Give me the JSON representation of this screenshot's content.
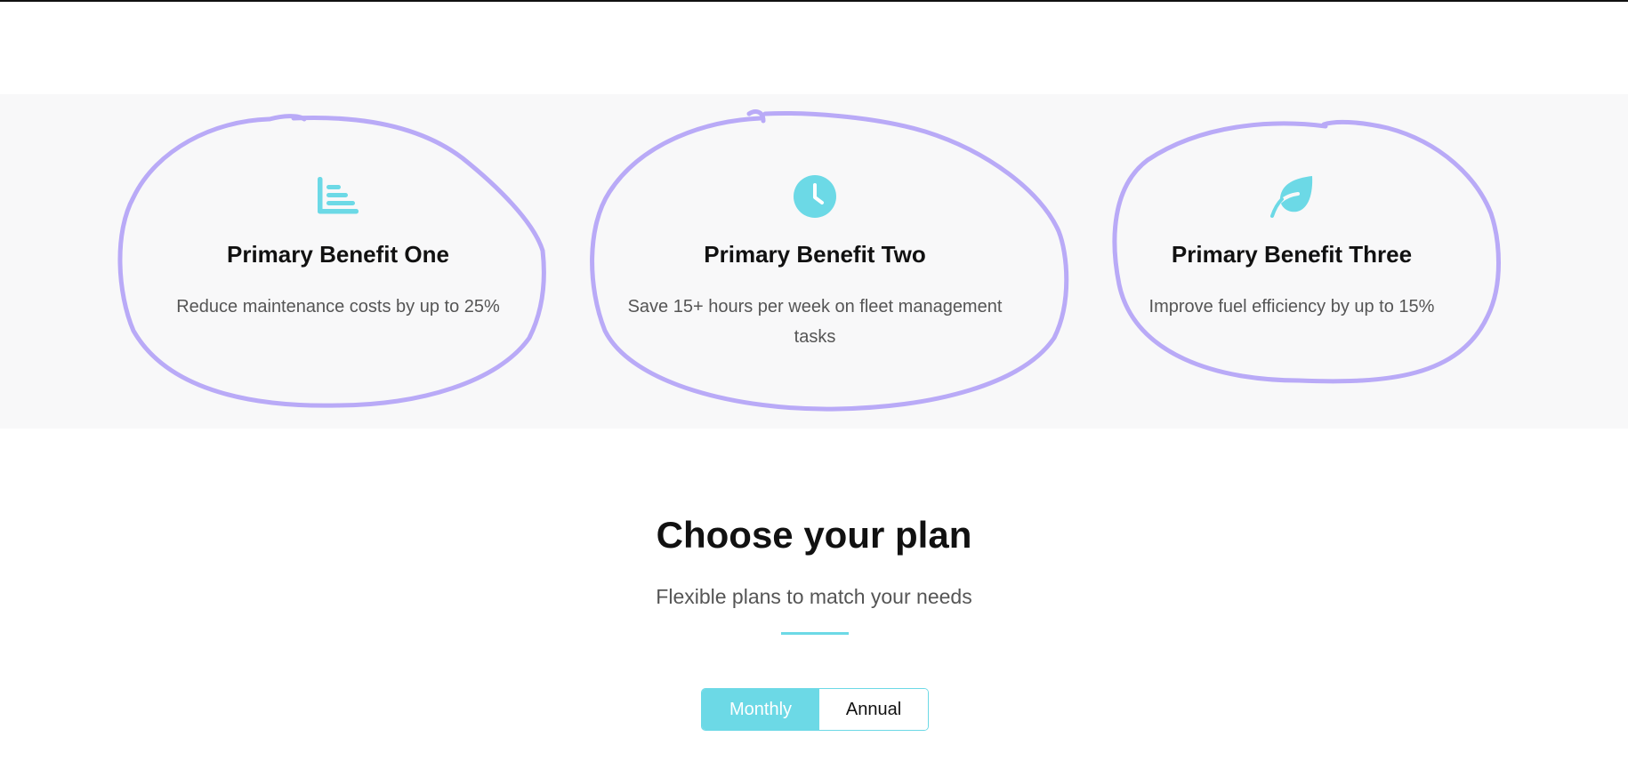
{
  "benefits": [
    {
      "icon": "bar-chart-icon",
      "title": "Primary Benefit One",
      "description": "Reduce maintenance costs by up to 25%"
    },
    {
      "icon": "clock-icon",
      "title": "Primary Benefit Two",
      "description": "Save 15+ hours per week on fleet management tasks"
    },
    {
      "icon": "leaf-icon",
      "title": "Primary Benefit Three",
      "description": "Improve fuel efficiency by up to 15%"
    }
  ],
  "plans": {
    "title": "Choose your plan",
    "subtitle": "Flexible plans to match your needs",
    "billing_options": [
      {
        "label": "Monthly",
        "selected": true
      },
      {
        "label": "Annual",
        "selected": false
      }
    ]
  },
  "colors": {
    "accent": "#6cd9e6",
    "scribble": "#b9aaf7",
    "band_background": "#f8f8f9",
    "heading_text": "#111111",
    "body_text": "#555555"
  }
}
